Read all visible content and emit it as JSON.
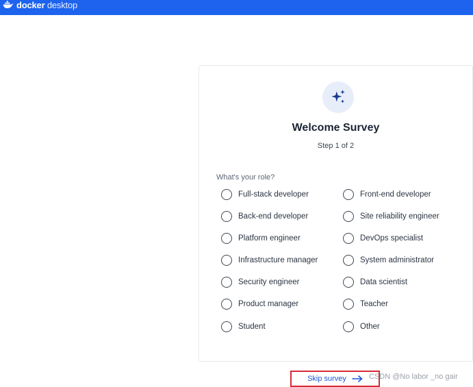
{
  "titlebar": {
    "brand_word1": "docker",
    "brand_word2": "desktop",
    "color": "#1d63ed"
  },
  "survey": {
    "icon": "sparkles-icon",
    "title": "Welcome Survey",
    "step": "Step 1 of 2",
    "question": "What's your role?",
    "options_left": [
      "Full-stack developer",
      "Back-end developer",
      "Platform engineer",
      "Infrastructure manager",
      "Security engineer",
      "Product manager",
      "Student"
    ],
    "options_right": [
      "Front-end developer",
      "Site reliability engineer",
      "DevOps specialist",
      "System administrator",
      "Data scientist",
      "Teacher",
      "Other"
    ],
    "skip_label": "Skip survey",
    "accent": "#1d57d6",
    "highlight": "#d62a35"
  },
  "watermark": "CSDN @No labor _no gair"
}
